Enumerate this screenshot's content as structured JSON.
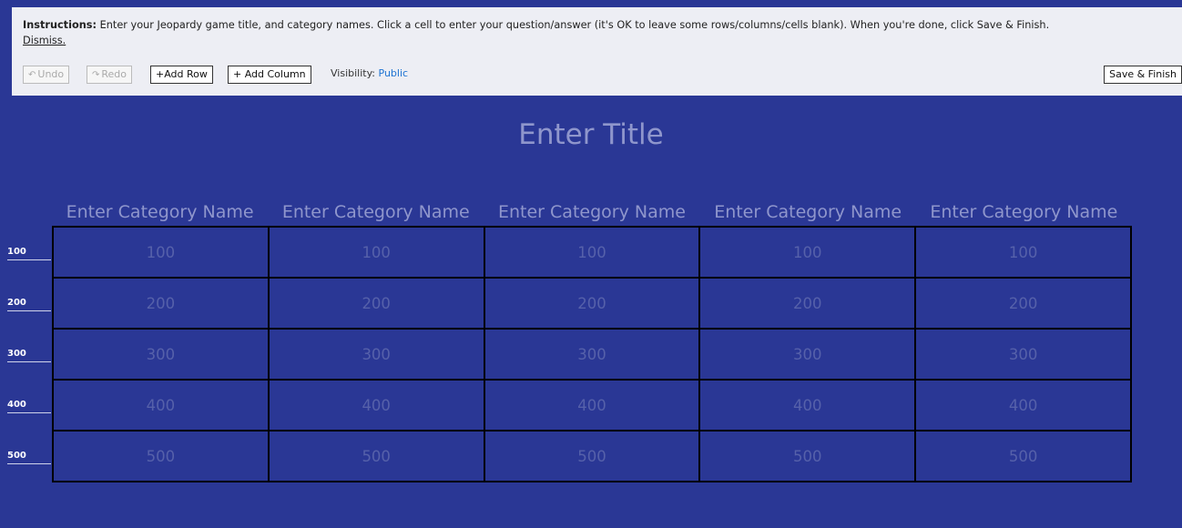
{
  "instructions": {
    "label": "Instructions:",
    "text": " Enter your Jeopardy game title, and category names. Click a cell to enter your question/answer (it's OK to leave some rows/columns/cells blank). When you're done, click Save & Finish.",
    "dismiss": "Dismiss."
  },
  "toolbar": {
    "undo": "Undo",
    "redo": "Redo",
    "add_row": "+Add Row",
    "add_column": "+ Add Column",
    "visibility_label": "Visibility: ",
    "visibility_value": "Public",
    "save": "Save & Finish"
  },
  "game": {
    "title": "Enter Title",
    "categories": [
      "Enter Category Name",
      "Enter Category Name",
      "Enter Category Name",
      "Enter Category Name",
      "Enter Category Name"
    ],
    "rows": [
      "100",
      "200",
      "300",
      "400",
      "500"
    ]
  }
}
